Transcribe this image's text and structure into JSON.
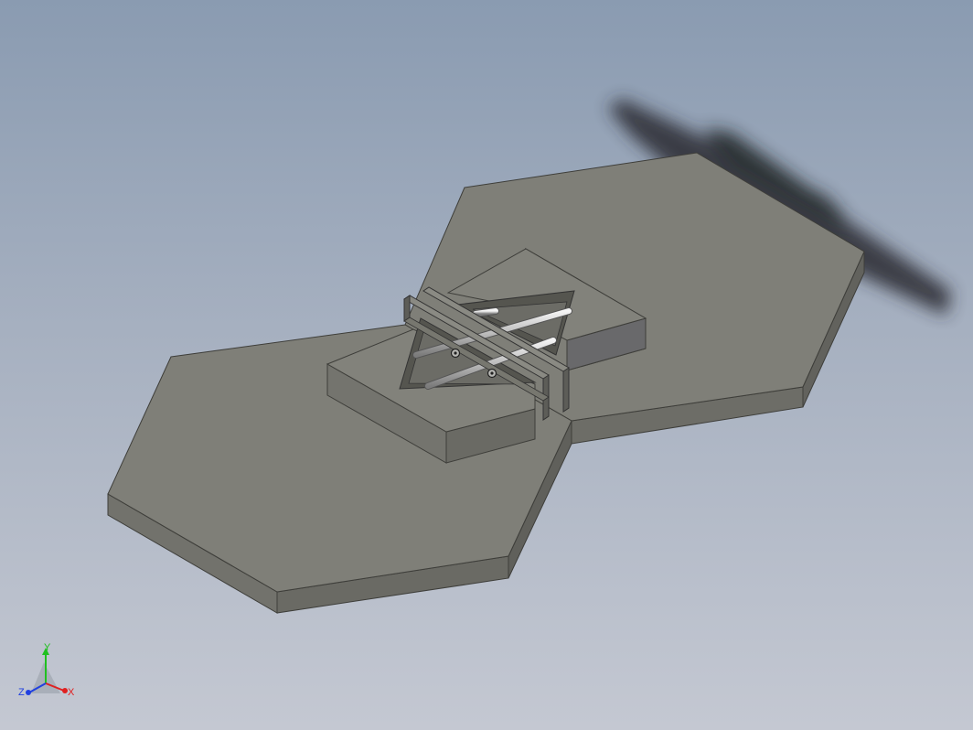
{
  "window": {
    "background_top": "#8a9bb1",
    "background_bottom": "#c4c8d2"
  },
  "model": {
    "part_name": "",
    "face_color_top": "#7f7f78",
    "face_color_side": "#6f6f69",
    "face_color_edge": "#5e5e59",
    "rod_color": "#d8d8d8"
  },
  "triad": {
    "x_label": "X",
    "y_label": "Y",
    "z_label": "Z",
    "x_color": "#e02020",
    "y_color": "#20c020",
    "z_color": "#2040e0"
  }
}
